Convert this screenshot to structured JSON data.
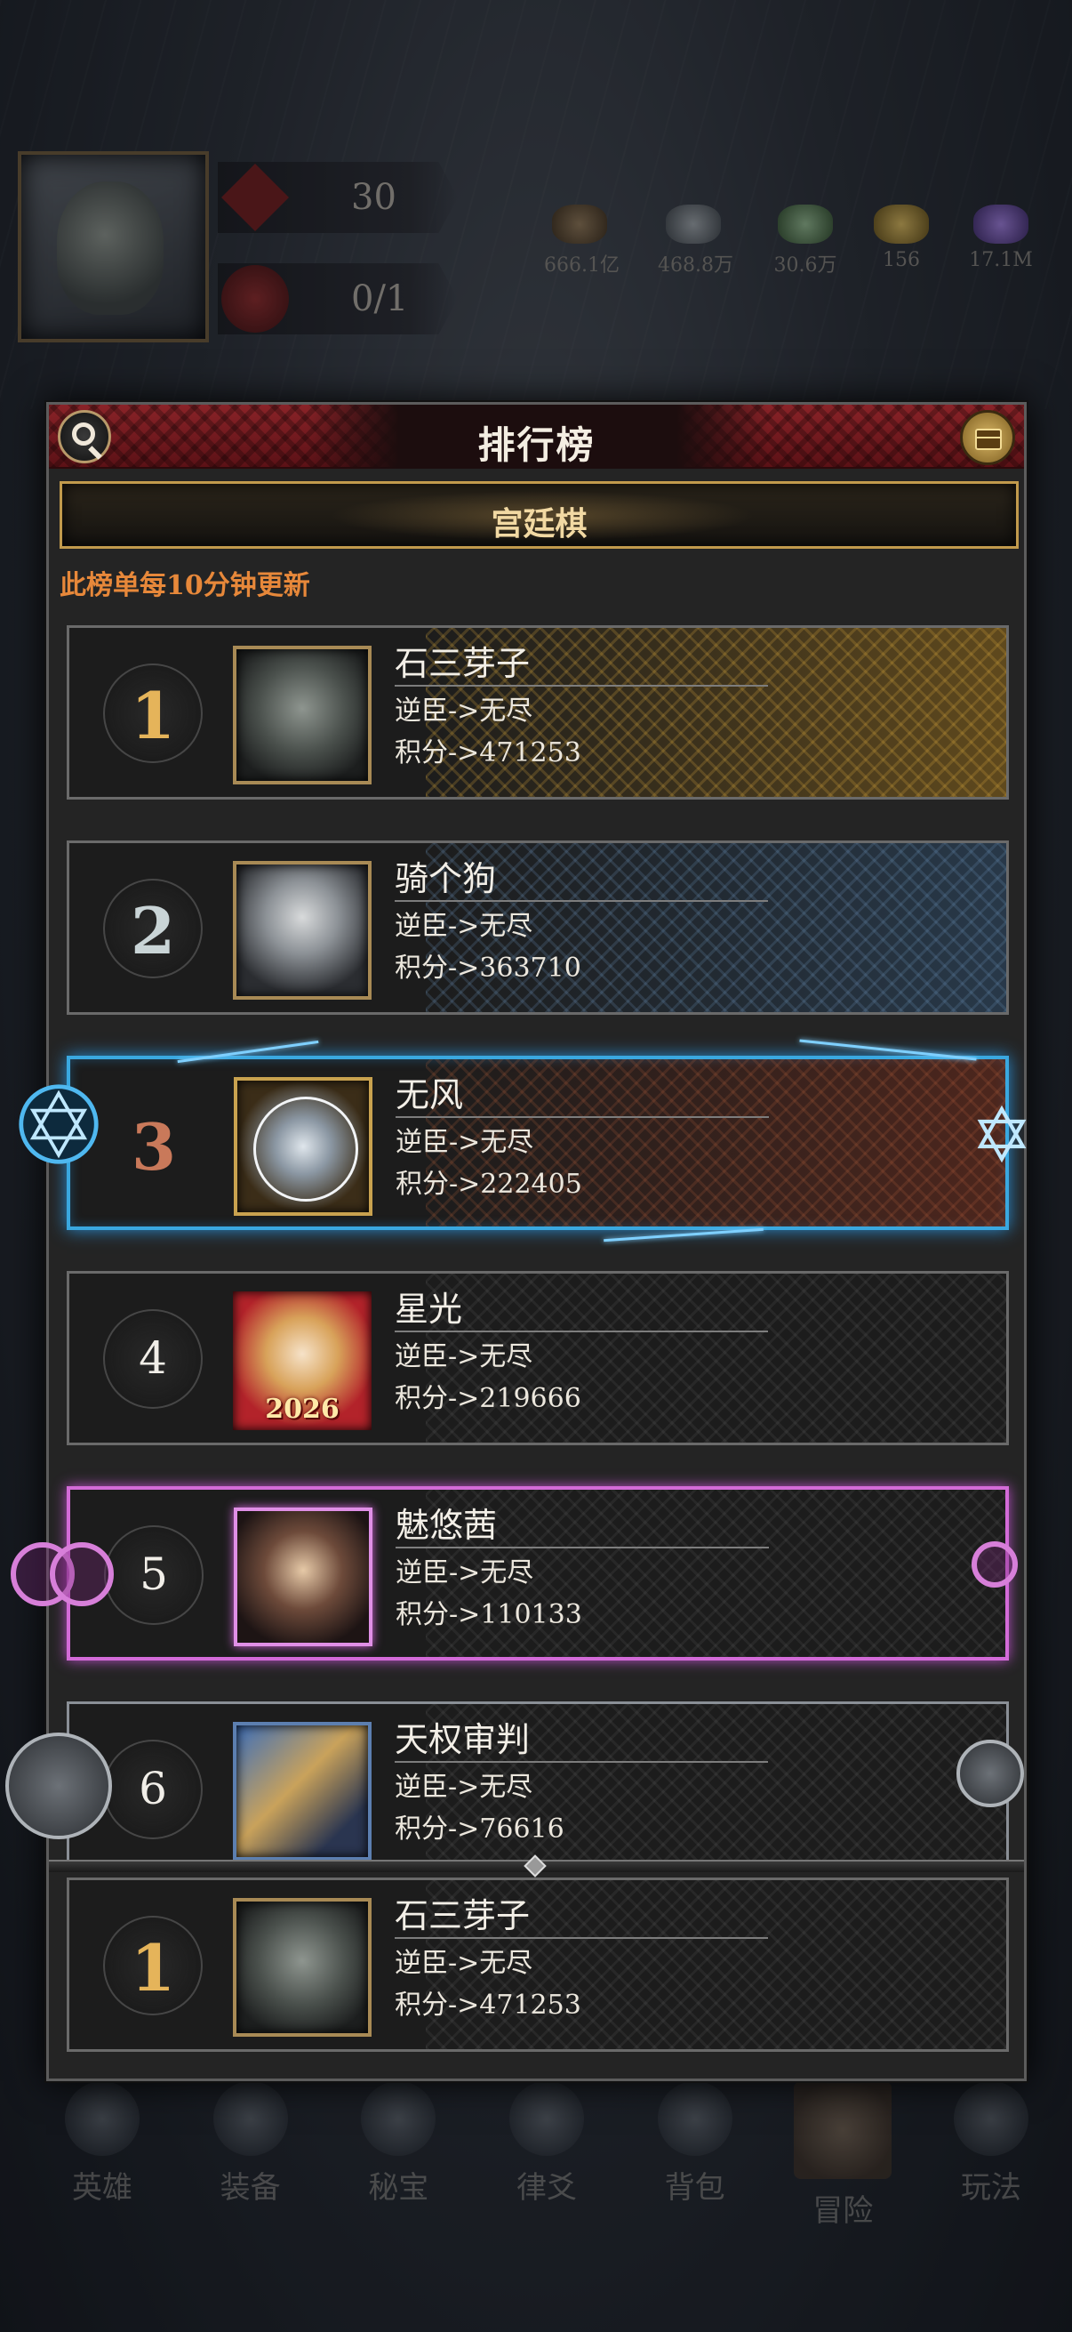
{
  "hud": {
    "stat_level": "30",
    "stat_count": "0/1",
    "resources": [
      "666.1亿",
      "468.8万",
      "30.6万",
      "156",
      "17.1M"
    ]
  },
  "panel": {
    "title": "排行榜",
    "tab": "宫廷棋",
    "notice": "此榜单每10分钟更新"
  },
  "rows": [
    {
      "rank": "1",
      "name": "石三芽子",
      "title": "逆臣->无尽",
      "score": "积分->471253"
    },
    {
      "rank": "2",
      "name": "骑个狗",
      "title": "逆臣->无尽",
      "score": "积分->363710"
    },
    {
      "rank": "3",
      "name": "无风",
      "title": "逆臣->无尽",
      "score": "积分->222405"
    },
    {
      "rank": "4",
      "name": "星光",
      "title": "逆臣->无尽",
      "score": "积分->219666",
      "avatar_text": "2026"
    },
    {
      "rank": "5",
      "name": "魅悠茜",
      "title": "逆臣->无尽",
      "score": "积分->110133"
    },
    {
      "rank": "6",
      "name": "天权审判",
      "title": "逆臣->无尽",
      "score": "积分->76616"
    }
  ],
  "self_row": {
    "rank": "1",
    "name": "石三芽子",
    "title": "逆臣->无尽",
    "score": "积分->471253"
  },
  "bottom_nav": [
    "英雄",
    "装备",
    "秘宝",
    "律爻",
    "背包",
    "冒险",
    "玩法"
  ],
  "colors": {
    "header_red": "#8a2328",
    "tab_gold": "#c19a4c",
    "notice_orange": "#e7883a",
    "rank3_blue": "#3aa8e0",
    "rank5_pink": "#d36bd8"
  },
  "icons": {
    "search": "search-icon",
    "reward": "treasure-chest-icon"
  }
}
